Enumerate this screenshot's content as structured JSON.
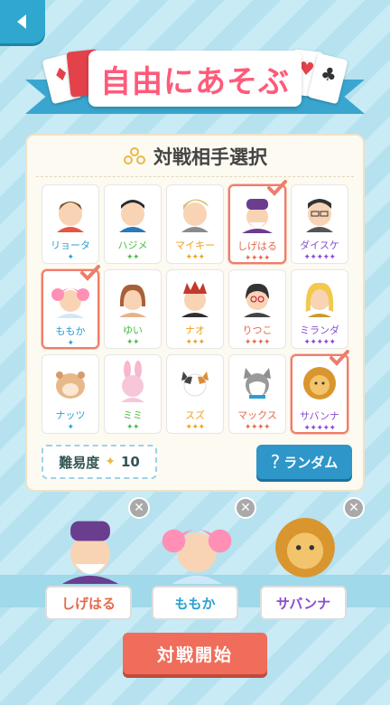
{
  "header": {
    "title": "自由にあそぶ"
  },
  "panel": {
    "title": "対戦相手選択"
  },
  "opponents": [
    {
      "name": "リョータ",
      "stars": "✦",
      "level": 1,
      "selected": false
    },
    {
      "name": "ハジメ",
      "stars": "✦✦",
      "level": 2,
      "selected": false
    },
    {
      "name": "マイキー",
      "stars": "✦✦✦",
      "level": 3,
      "selected": false
    },
    {
      "name": "しげはる",
      "stars": "✦✦✦✦",
      "level": 4,
      "selected": true
    },
    {
      "name": "ダイスケ",
      "stars": "✦✦✦✦✦",
      "level": 5,
      "selected": false
    },
    {
      "name": "ももか",
      "stars": "✦",
      "level": 1,
      "selected": true
    },
    {
      "name": "ゆい",
      "stars": "✦✦",
      "level": 2,
      "selected": false
    },
    {
      "name": "ナオ",
      "stars": "✦✦✦",
      "level": 3,
      "selected": false
    },
    {
      "name": "りつこ",
      "stars": "✦✦✦✦",
      "level": 4,
      "selected": false
    },
    {
      "name": "ミランダ",
      "stars": "✦✦✦✦✦",
      "level": 5,
      "selected": false
    },
    {
      "name": "ナッツ",
      "stars": "✦",
      "level": 1,
      "selected": false
    },
    {
      "name": "ミミ",
      "stars": "✦✦",
      "level": 2,
      "selected": false
    },
    {
      "name": "スズ",
      "stars": "✦✦✦",
      "level": 3,
      "selected": false
    },
    {
      "name": "マックス",
      "stars": "✦✦✦✦",
      "level": 4,
      "selected": false
    },
    {
      "name": "サバンナ",
      "stars": "✦✦✦✦✦",
      "level": 5,
      "selected": true
    }
  ],
  "difficulty": {
    "label": "難易度",
    "icon": "✦",
    "value": "10"
  },
  "random_button": {
    "icon": "?",
    "label": "ランダム"
  },
  "chosen": [
    {
      "name": "しげはる",
      "color": "#e26b4b"
    },
    {
      "name": "ももか",
      "color": "#2a9fd1"
    },
    {
      "name": "サバンナ",
      "color": "#8b4dd0"
    }
  ],
  "start_button": {
    "label": "対戦開始"
  },
  "colors": {
    "accent": "#2e96c8",
    "start": "#ef6d5a",
    "selected_border": "#ee7d6a"
  }
}
